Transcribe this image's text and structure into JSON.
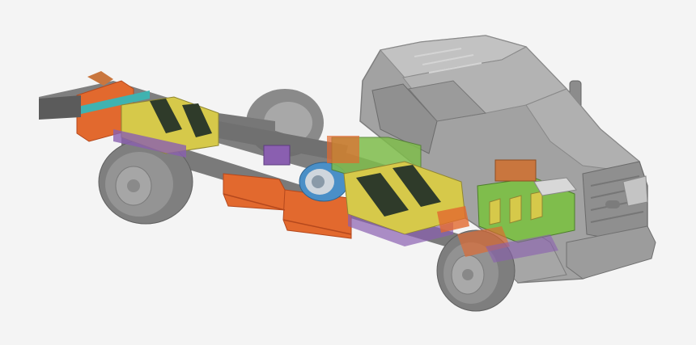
{
  "image": {
    "subject": "electric-truck-chassis-cutaway-render",
    "background_color": "#f4f4f4",
    "colors": {
      "body_gray": "#9a9a9a",
      "body_light": "#b8b8b8",
      "body_dark": "#6f6f6f",
      "tire": "#7d7d7d",
      "frame_dark": "#5b5b5b",
      "battery_yellow": "#d6c94a",
      "battery_dark_stripe": "#2f3b2a",
      "module_orange": "#e2692e",
      "module_orange_dark": "#b4481d",
      "controller_green": "#7fbd4c",
      "bracket_teal": "#3fb2b0",
      "harness_purple": "#8a5fb0",
      "motor_blue": "#4a8fc7",
      "copper_box": "#c9763e"
    }
  }
}
